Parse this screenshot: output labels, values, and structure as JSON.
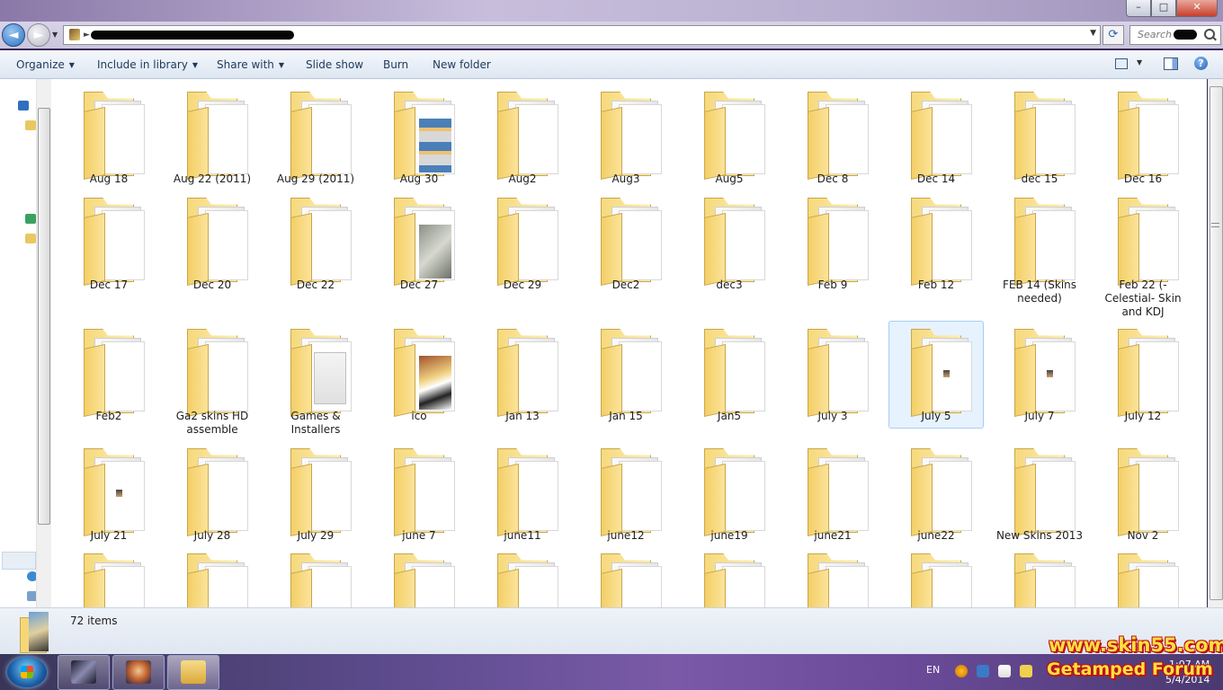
{
  "window": {
    "min": "–",
    "max": "□",
    "close": "✕"
  },
  "address": {
    "search_placeholder": "Search"
  },
  "toolbar": {
    "organize": "Organize",
    "include": "Include in library",
    "share": "Share with",
    "slideshow": "Slide show",
    "burn": "Burn",
    "new_folder": "New folder"
  },
  "folders": [
    "Aug 18",
    "Aug 22 (2011)",
    "Aug 29 (2011)",
    "Aug 30",
    "Aug2",
    "Aug3",
    "Aug5",
    "Dec 8",
    "Dec 14",
    "dec 15",
    "Dec 16",
    "Dec 17",
    "Dec 20",
    "Dec 22",
    "Dec 27",
    "Dec 29",
    "Dec2",
    "dec3",
    "Feb 9",
    "Feb 12",
    "FEB 14 (Skins needed)",
    "Feb 22 (-Celestial- Skin and KDJ",
    "Feb2",
    "Ga2 skins HD assemble",
    "Games & Installers",
    "ico",
    "Jan 13",
    "Jan 15",
    "Jan5",
    "July 3",
    "July 5",
    "July 7",
    "July 12",
    "July 21",
    "July 28",
    "July 29",
    "june 7",
    "june11",
    "june12",
    "june19",
    "june21",
    "june22",
    "New Skins 2013",
    "Nov 2",
    "",
    "",
    "",
    "",
    "",
    "",
    "",
    "",
    "",
    "",
    ""
  ],
  "status": {
    "item_count": "72 items"
  },
  "taskbar": {
    "language": "EN",
    "time": "1:07 AM",
    "date": "5/4/2014"
  },
  "watermark": {
    "site": "www.skin55.com",
    "forum": "Getamped Forum"
  }
}
